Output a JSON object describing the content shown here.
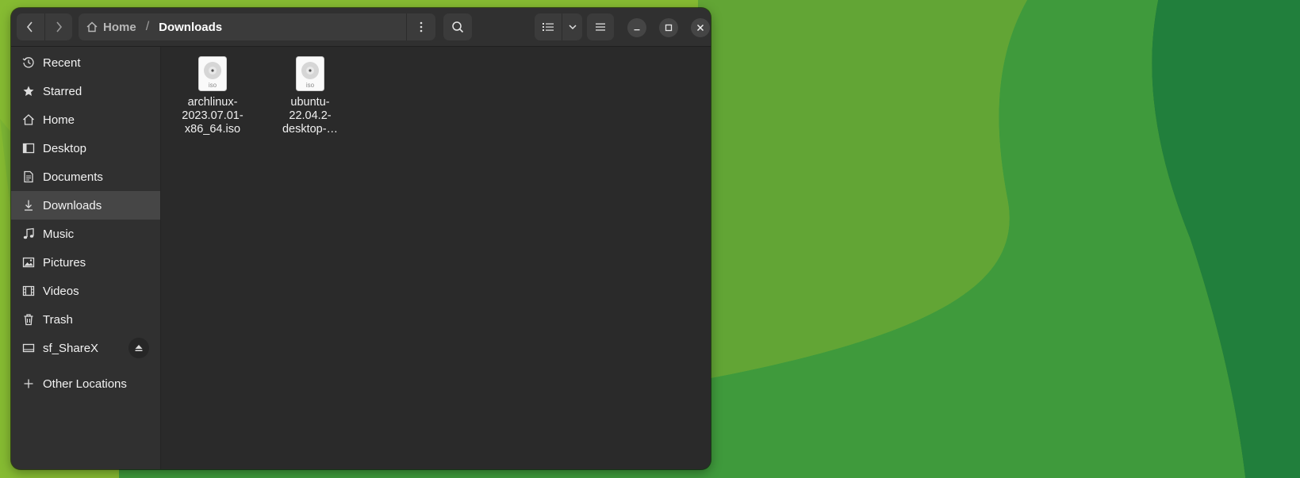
{
  "header": {
    "path": {
      "home_label": "Home",
      "separator": "/",
      "current": "Downloads"
    }
  },
  "icons": {
    "back": "chevron-left-icon",
    "forward": "chevron-right-icon",
    "home": "home-icon",
    "path_menu": "kebab-menu-icon",
    "search": "search-icon",
    "view_list": "list-view-icon",
    "view_options": "chevron-down-icon",
    "main_menu": "hamburger-menu-icon",
    "minimize": "minimize-icon",
    "maximize": "maximize-icon",
    "close": "close-icon"
  },
  "sidebar": {
    "items": [
      {
        "label": "Recent",
        "icon": "clock-icon",
        "active": false
      },
      {
        "label": "Starred",
        "icon": "star-icon",
        "active": false
      },
      {
        "label": "Home",
        "icon": "home-icon",
        "active": false
      },
      {
        "label": "Desktop",
        "icon": "desktop-icon",
        "active": false
      },
      {
        "label": "Documents",
        "icon": "document-icon",
        "active": false
      },
      {
        "label": "Downloads",
        "icon": "download-icon",
        "active": true
      },
      {
        "label": "Music",
        "icon": "music-icon",
        "active": false
      },
      {
        "label": "Pictures",
        "icon": "picture-icon",
        "active": false
      },
      {
        "label": "Videos",
        "icon": "video-icon",
        "active": false
      },
      {
        "label": "Trash",
        "icon": "trash-icon",
        "active": false
      },
      {
        "label": "sf_ShareX",
        "icon": "drive-icon",
        "active": false
      },
      {
        "label": "Other Locations",
        "icon": "plus-icon",
        "active": false
      }
    ]
  },
  "files": [
    {
      "name_lines": [
        "archlinux-",
        "2023.07.01-",
        "x86_64.iso"
      ],
      "type_label": "iso"
    },
    {
      "name_lines": [
        "ubuntu-",
        "22.04.2-",
        "desktop-…"
      ],
      "type_label": "iso"
    }
  ],
  "colors": {
    "window_bg": "#2a2a2a",
    "sidebar_bg": "#303030",
    "active_item": "#464646",
    "wallpaper_light": "#86bb32",
    "wallpaper_mid": "#62a535",
    "wallpaper_dark": "#217f3c"
  }
}
